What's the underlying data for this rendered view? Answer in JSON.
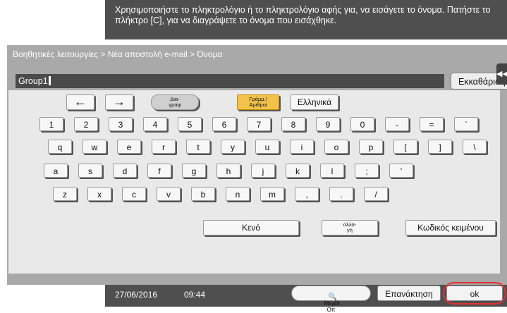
{
  "header": {
    "message": "Χρησιμοποιήστε το πληκτρολόγιο ή το πληκτρολόγιο αφής για, να εισάγετε το όνομα. Πατήστε το πλήκτρο [C], για να διαγράψετε το όνομα που εισάχθηκε."
  },
  "breadcrumb": "Βοηθητικές λειτουργίες > Νέα αποστολή e-mail > Όνομα",
  "input": {
    "value": "Group1"
  },
  "clear_label": "Εκκαθάριση",
  "keyboard": {
    "left_arrow": "←",
    "right_arrow": "→",
    "layout_label": "Δια-\nγραφ",
    "mode_label": "Γράμμ./\nΑριθμοί",
    "greek_label": "Ελληνικά",
    "row1": [
      "1",
      "2",
      "3",
      "4",
      "5",
      "6",
      "7",
      "8",
      "9",
      "0",
      "-",
      "=",
      "`"
    ],
    "row2": [
      "q",
      "w",
      "e",
      "r",
      "t",
      "y",
      "u",
      "i",
      "o",
      "p",
      "[",
      "]",
      "\\"
    ],
    "row3": [
      "a",
      "s",
      "d",
      "f",
      "g",
      "h",
      "j",
      "k",
      "l",
      ";",
      "'"
    ],
    "row4": [
      "z",
      "x",
      "c",
      "v",
      "b",
      "n",
      "m",
      ",",
      ".",
      "/"
    ],
    "space_label": "Κενό",
    "shift_label": "αλλα-\nγή",
    "text_code_label": "Κωδικός κειμένου"
  },
  "footer": {
    "date": "27/06/2016",
    "time": "09:44",
    "enlarge_label": "Μεγέθ.\nΟπ",
    "repeat_label": "Επανάκτηση",
    "ok_label": "ok"
  }
}
